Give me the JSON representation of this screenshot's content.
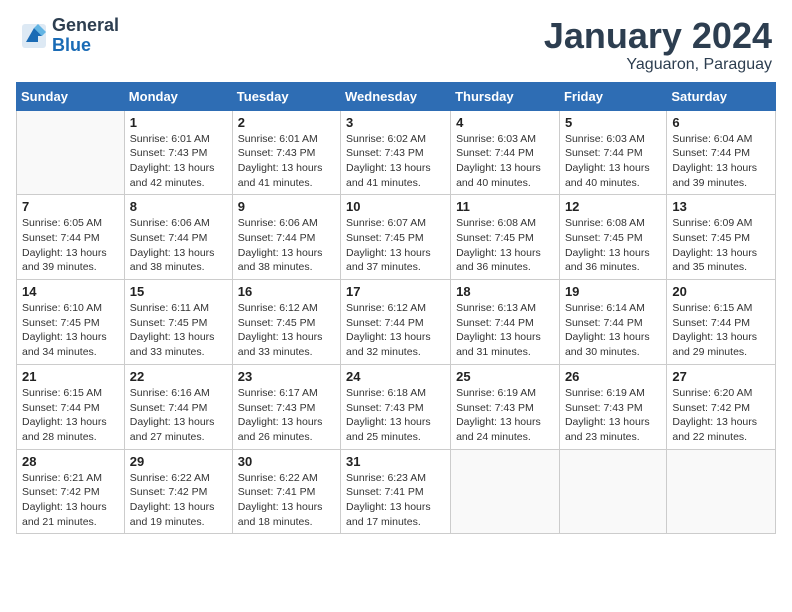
{
  "header": {
    "logo_general": "General",
    "logo_blue": "Blue",
    "month_title": "January 2024",
    "location": "Yaguaron, Paraguay"
  },
  "weekdays": [
    "Sunday",
    "Monday",
    "Tuesday",
    "Wednesday",
    "Thursday",
    "Friday",
    "Saturday"
  ],
  "weeks": [
    [
      {
        "day": "",
        "sunrise": "",
        "sunset": "",
        "daylight": ""
      },
      {
        "day": "1",
        "sunrise": "6:01 AM",
        "sunset": "7:43 PM",
        "daylight": "13 hours and 42 minutes."
      },
      {
        "day": "2",
        "sunrise": "6:01 AM",
        "sunset": "7:43 PM",
        "daylight": "13 hours and 41 minutes."
      },
      {
        "day": "3",
        "sunrise": "6:02 AM",
        "sunset": "7:43 PM",
        "daylight": "13 hours and 41 minutes."
      },
      {
        "day": "4",
        "sunrise": "6:03 AM",
        "sunset": "7:44 PM",
        "daylight": "13 hours and 40 minutes."
      },
      {
        "day": "5",
        "sunrise": "6:03 AM",
        "sunset": "7:44 PM",
        "daylight": "13 hours and 40 minutes."
      },
      {
        "day": "6",
        "sunrise": "6:04 AM",
        "sunset": "7:44 PM",
        "daylight": "13 hours and 39 minutes."
      }
    ],
    [
      {
        "day": "7",
        "sunrise": "6:05 AM",
        "sunset": "7:44 PM",
        "daylight": "13 hours and 39 minutes."
      },
      {
        "day": "8",
        "sunrise": "6:06 AM",
        "sunset": "7:44 PM",
        "daylight": "13 hours and 38 minutes."
      },
      {
        "day": "9",
        "sunrise": "6:06 AM",
        "sunset": "7:44 PM",
        "daylight": "13 hours and 38 minutes."
      },
      {
        "day": "10",
        "sunrise": "6:07 AM",
        "sunset": "7:45 PM",
        "daylight": "13 hours and 37 minutes."
      },
      {
        "day": "11",
        "sunrise": "6:08 AM",
        "sunset": "7:45 PM",
        "daylight": "13 hours and 36 minutes."
      },
      {
        "day": "12",
        "sunrise": "6:08 AM",
        "sunset": "7:45 PM",
        "daylight": "13 hours and 36 minutes."
      },
      {
        "day": "13",
        "sunrise": "6:09 AM",
        "sunset": "7:45 PM",
        "daylight": "13 hours and 35 minutes."
      }
    ],
    [
      {
        "day": "14",
        "sunrise": "6:10 AM",
        "sunset": "7:45 PM",
        "daylight": "13 hours and 34 minutes."
      },
      {
        "day": "15",
        "sunrise": "6:11 AM",
        "sunset": "7:45 PM",
        "daylight": "13 hours and 33 minutes."
      },
      {
        "day": "16",
        "sunrise": "6:12 AM",
        "sunset": "7:45 PM",
        "daylight": "13 hours and 33 minutes."
      },
      {
        "day": "17",
        "sunrise": "6:12 AM",
        "sunset": "7:44 PM",
        "daylight": "13 hours and 32 minutes."
      },
      {
        "day": "18",
        "sunrise": "6:13 AM",
        "sunset": "7:44 PM",
        "daylight": "13 hours and 31 minutes."
      },
      {
        "day": "19",
        "sunrise": "6:14 AM",
        "sunset": "7:44 PM",
        "daylight": "13 hours and 30 minutes."
      },
      {
        "day": "20",
        "sunrise": "6:15 AM",
        "sunset": "7:44 PM",
        "daylight": "13 hours and 29 minutes."
      }
    ],
    [
      {
        "day": "21",
        "sunrise": "6:15 AM",
        "sunset": "7:44 PM",
        "daylight": "13 hours and 28 minutes."
      },
      {
        "day": "22",
        "sunrise": "6:16 AM",
        "sunset": "7:44 PM",
        "daylight": "13 hours and 27 minutes."
      },
      {
        "day": "23",
        "sunrise": "6:17 AM",
        "sunset": "7:43 PM",
        "daylight": "13 hours and 26 minutes."
      },
      {
        "day": "24",
        "sunrise": "6:18 AM",
        "sunset": "7:43 PM",
        "daylight": "13 hours and 25 minutes."
      },
      {
        "day": "25",
        "sunrise": "6:19 AM",
        "sunset": "7:43 PM",
        "daylight": "13 hours and 24 minutes."
      },
      {
        "day": "26",
        "sunrise": "6:19 AM",
        "sunset": "7:43 PM",
        "daylight": "13 hours and 23 minutes."
      },
      {
        "day": "27",
        "sunrise": "6:20 AM",
        "sunset": "7:42 PM",
        "daylight": "13 hours and 22 minutes."
      }
    ],
    [
      {
        "day": "28",
        "sunrise": "6:21 AM",
        "sunset": "7:42 PM",
        "daylight": "13 hours and 21 minutes."
      },
      {
        "day": "29",
        "sunrise": "6:22 AM",
        "sunset": "7:42 PM",
        "daylight": "13 hours and 19 minutes."
      },
      {
        "day": "30",
        "sunrise": "6:22 AM",
        "sunset": "7:41 PM",
        "daylight": "13 hours and 18 minutes."
      },
      {
        "day": "31",
        "sunrise": "6:23 AM",
        "sunset": "7:41 PM",
        "daylight": "13 hours and 17 minutes."
      },
      {
        "day": "",
        "sunrise": "",
        "sunset": "",
        "daylight": ""
      },
      {
        "day": "",
        "sunrise": "",
        "sunset": "",
        "daylight": ""
      },
      {
        "day": "",
        "sunrise": "",
        "sunset": "",
        "daylight": ""
      }
    ]
  ],
  "labels": {
    "sunrise": "Sunrise:",
    "sunset": "Sunset:",
    "daylight": "Daylight:"
  }
}
